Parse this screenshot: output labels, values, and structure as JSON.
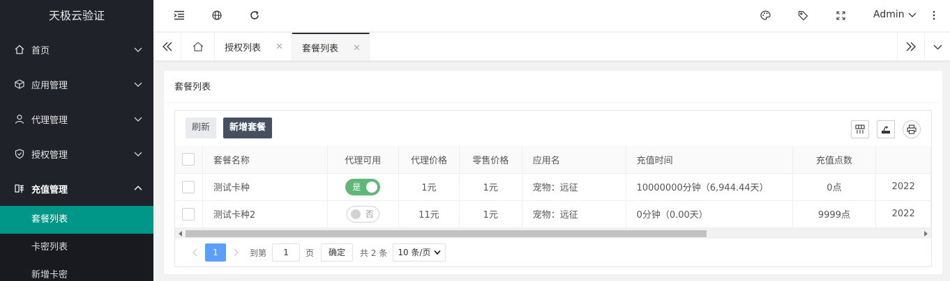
{
  "app": {
    "title": "天极云验证"
  },
  "sidebar": {
    "items": [
      {
        "label": "首页",
        "icon": "home-icon"
      },
      {
        "label": "应用管理",
        "icon": "cube-icon"
      },
      {
        "label": "代理管理",
        "icon": "user-icon"
      },
      {
        "label": "授权管理",
        "icon": "shield-icon"
      },
      {
        "label": "充值管理",
        "icon": "recharge-icon",
        "open": true
      }
    ],
    "sub_items": [
      {
        "label": "套餐列表",
        "active": true
      },
      {
        "label": "卡密列表"
      },
      {
        "label": "新增卡密"
      }
    ],
    "active_color": "#009688"
  },
  "header": {
    "user": "Admin"
  },
  "tabs": [
    {
      "label": "授权列表"
    },
    {
      "label": "套餐列表",
      "active": true
    }
  ],
  "card": {
    "title": "套餐列表"
  },
  "toolbar": {
    "refresh": "刷新",
    "add": "新增套餐"
  },
  "table": {
    "headers": [
      "套餐名称",
      "代理可用",
      "代理价格",
      "零售价格",
      "应用名",
      "充值时间",
      "充值点数",
      ""
    ],
    "rows": [
      {
        "name": "测试卡种",
        "agent": "是",
        "agent_on": true,
        "agent_price": "1元",
        "retail_price": "1元",
        "app": "宠物：远征",
        "time": "10000000分钟（6,944.44天）",
        "points": "0点",
        "date": "2022"
      },
      {
        "name": "测试卡种2",
        "agent": "否",
        "agent_on": false,
        "agent_price": "11元",
        "retail_price": "1元",
        "app": "宠物：远征",
        "time": "0分钟（0.00天）",
        "points": "9999点",
        "date": "2022"
      }
    ]
  },
  "pager": {
    "current": "1",
    "goto_label": "到第",
    "goto_value": "1",
    "page_unit": "页",
    "confirm": "确定",
    "total": "共 2 条",
    "page_size": "10 条/页"
  }
}
